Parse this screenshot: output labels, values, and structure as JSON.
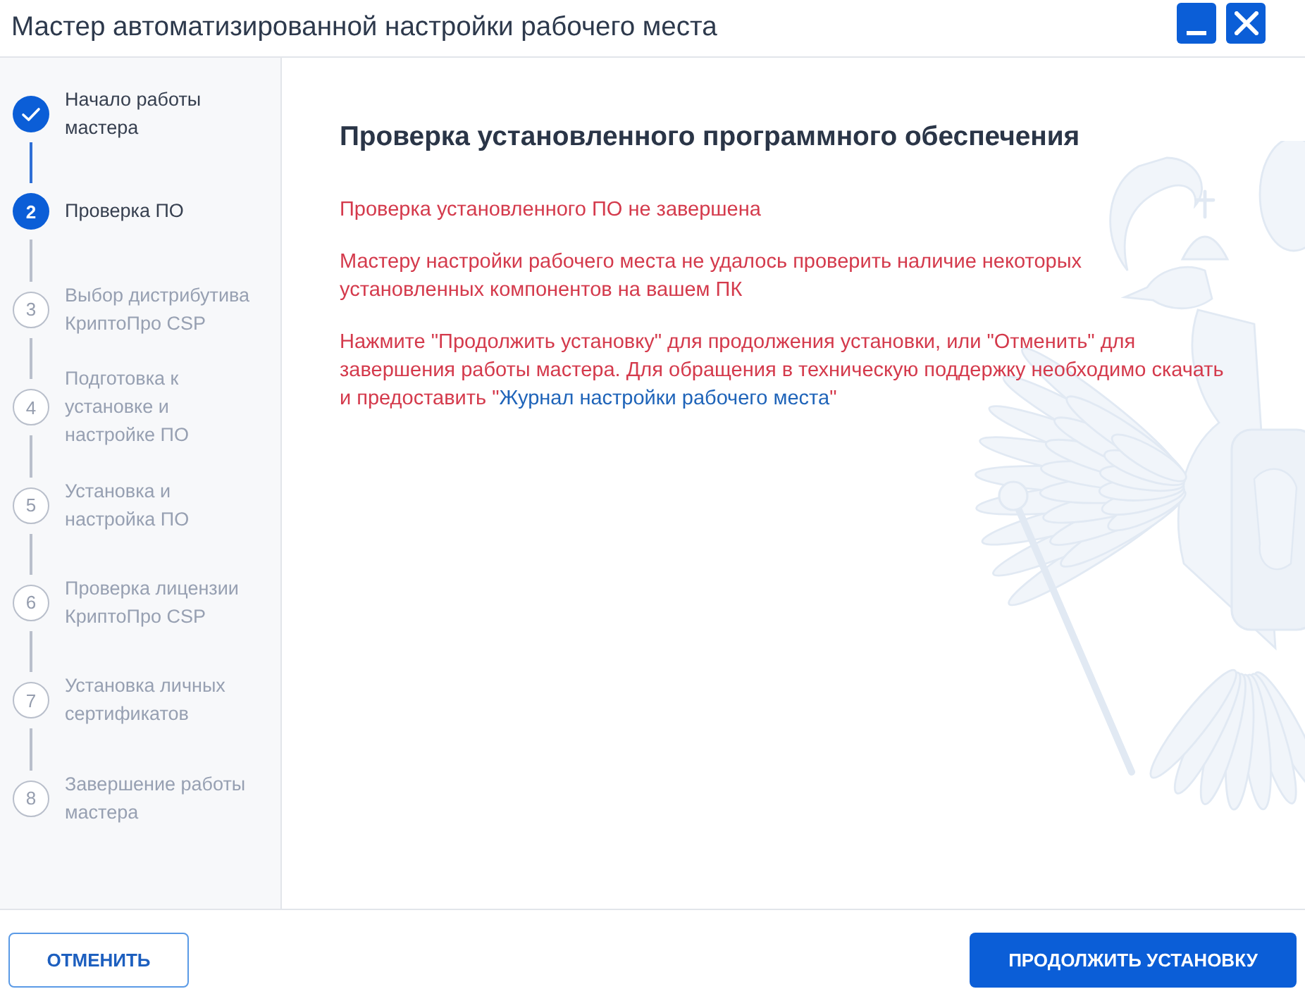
{
  "window": {
    "title": "Мастер автоматизированной настройки рабочего места"
  },
  "steps": [
    {
      "label": "Начало работы мастера",
      "done": true,
      "selected": false
    },
    {
      "number": "2",
      "label": "Проверка ПО",
      "done": false,
      "selected": true
    },
    {
      "number": "3",
      "label": "Выбор дистрибутива КриптоПро CSP",
      "done": false,
      "selected": false
    },
    {
      "number": "4",
      "label": "Подготовка к установке и настройке ПО",
      "done": false,
      "selected": false
    },
    {
      "number": "5",
      "label": "Установка и настройка ПО",
      "done": false,
      "selected": false
    },
    {
      "number": "6",
      "label": "Проверка лицензии КриптоПро CSP",
      "done": false,
      "selected": false
    },
    {
      "number": "7",
      "label": "Установка личных сертификатов",
      "done": false,
      "selected": false
    },
    {
      "number": "8",
      "label": "Завершение работы мастера",
      "done": false,
      "selected": false
    }
  ],
  "content": {
    "heading": "Проверка установленного программного обеспечения",
    "messages": [
      {
        "text": "Проверка установленного ПО не завершена"
      },
      {
        "text": "Мастеру настройки рабочего места не удалось проверить наличие некоторых установленных компонентов на вашем ПК"
      },
      {
        "text": "Нажмите \"Продолжить установку\" для продолжения установки, или \"Отменить\" для завершения работы мастера. Для обращения в техническую поддержку необходимо скачать и предоставить \"",
        "link": "Журнал настройки рабочего места",
        "text_after": "\""
      }
    ]
  },
  "buttons": [
    {
      "label": "ОТМЕНИТЬ",
      "kind": "secondary"
    },
    {
      "label": "ПРОДОЛЖИТЬ УСТАНОВКУ",
      "kind": "primary"
    }
  ]
}
